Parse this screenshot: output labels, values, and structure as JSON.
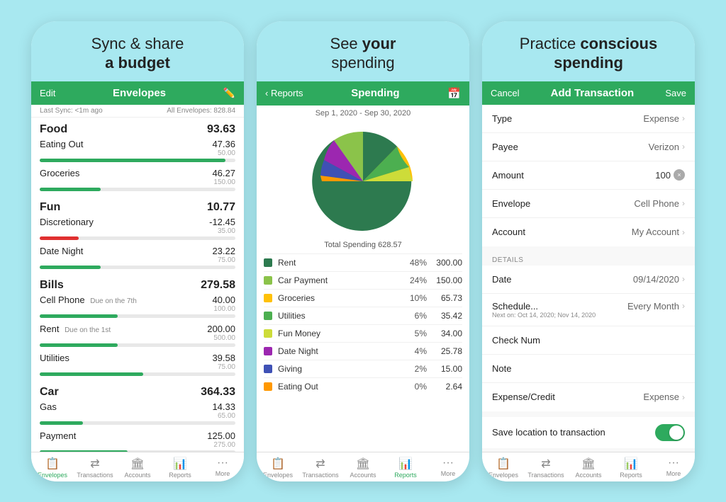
{
  "phone1": {
    "heading": "Sync & share a budget",
    "heading_parts": [
      "Sync & share",
      "a budget"
    ],
    "header": {
      "edit": "Edit",
      "title": "Envelopes",
      "icon": "✏️"
    },
    "subheader": {
      "sync": "Last Sync: <1m ago",
      "total": "All Envelopes: 828.84"
    },
    "groups": [
      {
        "name": "Food",
        "total": "93.63",
        "items": [
          {
            "name": "Eating Out",
            "note": "",
            "amount": "47.36",
            "budget": "50.00",
            "fill": 95,
            "red": false
          },
          {
            "name": "Groceries",
            "note": "",
            "amount": "46.27",
            "budget": "150.00",
            "fill": 31,
            "red": false
          }
        ]
      },
      {
        "name": "Fun",
        "total": "10.77",
        "items": [
          {
            "name": "Discretionary",
            "note": "",
            "amount": "-12.45",
            "budget": "35.00",
            "fill": 20,
            "red": true
          },
          {
            "name": "Date Night",
            "note": "",
            "amount": "23.22",
            "budget": "75.00",
            "fill": 31,
            "red": false
          }
        ]
      },
      {
        "name": "Bills",
        "total": "279.58",
        "items": [
          {
            "name": "Cell Phone",
            "note": "Due on the 7th",
            "amount": "40.00",
            "budget": "100.00",
            "fill": 40,
            "red": false
          },
          {
            "name": "Rent",
            "note": "Due on the 1st",
            "amount": "200.00",
            "budget": "500.00",
            "fill": 40,
            "red": false
          },
          {
            "name": "Utilities",
            "note": "",
            "amount": "39.58",
            "budget": "75.00",
            "fill": 53,
            "red": false
          }
        ]
      },
      {
        "name": "Car",
        "total": "364.33",
        "items": [
          {
            "name": "Gas",
            "note": "",
            "amount": "14.33",
            "budget": "65.00",
            "fill": 22,
            "red": false
          },
          {
            "name": "Payment",
            "note": "",
            "amount": "125.00",
            "budget": "275.00",
            "fill": 45,
            "red": false
          }
        ]
      }
    ],
    "tabs": [
      {
        "icon": "📋",
        "label": "Envelopes",
        "active": true
      },
      {
        "icon": "↔",
        "label": "Transactions",
        "active": false
      },
      {
        "icon": "🏦",
        "label": "Accounts",
        "active": false
      },
      {
        "icon": "📊",
        "label": "Reports",
        "active": false
      },
      {
        "icon": "···",
        "label": "More",
        "active": false
      }
    ]
  },
  "phone2": {
    "heading_parts": [
      "See your",
      "spending"
    ],
    "header": {
      "back": "< Reports",
      "title": "Spending",
      "icon": "📅"
    },
    "date_range": "Sep 1, 2020 - Sep 30, 2020",
    "total_label": "Total Spending 628.57",
    "legend": [
      {
        "color": "#2d7a4f",
        "name": "Rent",
        "pct": "48%",
        "amount": "300.00"
      },
      {
        "color": "#8bc34a",
        "name": "Car Payment",
        "pct": "24%",
        "amount": "150.00"
      },
      {
        "color": "#ffc107",
        "name": "Groceries",
        "pct": "10%",
        "amount": "65.73"
      },
      {
        "color": "#4caf50",
        "name": "Utilities",
        "pct": "6%",
        "amount": "35.42"
      },
      {
        "color": "#cddc39",
        "name": "Fun Money",
        "pct": "5%",
        "amount": "34.00"
      },
      {
        "color": "#9c27b0",
        "name": "Date Night",
        "pct": "4%",
        "amount": "25.78"
      },
      {
        "color": "#3f51b5",
        "name": "Giving",
        "pct": "2%",
        "amount": "15.00"
      },
      {
        "color": "#ff9800",
        "name": "Eating Out",
        "pct": "0%",
        "amount": "2.64"
      }
    ],
    "tabs": [
      {
        "icon": "📋",
        "label": "Envelopes",
        "active": false
      },
      {
        "icon": "↔",
        "label": "Transactions",
        "active": false
      },
      {
        "icon": "🏦",
        "label": "Accounts",
        "active": false
      },
      {
        "icon": "📊",
        "label": "Reports",
        "active": true
      },
      {
        "icon": "···",
        "label": "More",
        "active": false
      }
    ]
  },
  "phone3": {
    "heading_parts": [
      "Practice",
      "conscious spending"
    ],
    "heading_bold_start": 1,
    "header": {
      "cancel": "Cancel",
      "title": "Add Transaction",
      "save": "Save"
    },
    "fields": [
      {
        "label": "Type",
        "value": "Expense",
        "chevron": true
      },
      {
        "label": "Payee",
        "value": "Verizon",
        "chevron": true
      },
      {
        "label": "Amount",
        "value": "100",
        "is_amount": true,
        "chevron": false
      },
      {
        "label": "Envelope",
        "value": "Cell Phone",
        "chevron": true
      },
      {
        "label": "Account",
        "value": "My Account",
        "chevron": true
      }
    ],
    "details_label": "DETAILS",
    "details_fields": [
      {
        "label": "Date",
        "value": "09/14/2020",
        "chevron": true,
        "sub": ""
      },
      {
        "label": "Schedule...",
        "value": "Every Month",
        "chevron": true,
        "sub": "Next on: Oct 14, 2020; Nov 14, 2020"
      },
      {
        "label": "Check Num",
        "value": "",
        "chevron": false
      },
      {
        "label": "Note",
        "value": "",
        "chevron": false
      },
      {
        "label": "Expense/Credit",
        "value": "Expense",
        "chevron": true
      }
    ],
    "toggle_row": {
      "label": "Save location to transaction",
      "enabled": true
    },
    "tabs": [
      {
        "icon": "📋",
        "label": "Envelopes",
        "active": false
      },
      {
        "icon": "↔",
        "label": "Transactions",
        "active": false
      },
      {
        "icon": "🏦",
        "label": "Accounts",
        "active": false
      },
      {
        "icon": "📊",
        "label": "Reports",
        "active": false
      },
      {
        "icon": "···",
        "label": "More",
        "active": false
      }
    ]
  }
}
